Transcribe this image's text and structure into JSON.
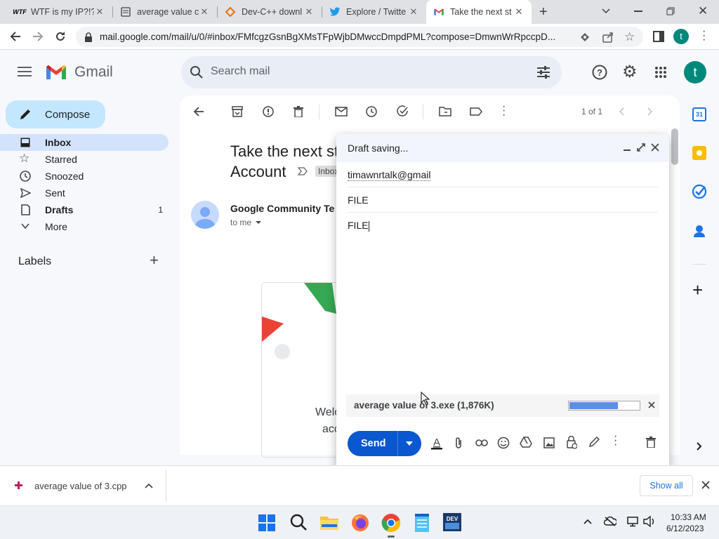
{
  "browser": {
    "tabs": [
      {
        "title": "WTF is my IP?!?!",
        "favicon": "WTF",
        "active": false
      },
      {
        "title": "average value c",
        "favicon": "doc-icon",
        "active": false
      },
      {
        "title": "Dev-C++ downl",
        "favicon": "diamond-icon",
        "active": false
      },
      {
        "title": "Explore / Twitte",
        "favicon": "twitter-icon",
        "active": false
      },
      {
        "title": "Take the next st",
        "favicon": "gmail-icon",
        "active": true
      }
    ],
    "url": "mail.google.com/mail/u/0/#inbox/FMfcgzGsnBgXMsTFpWjbDMwccDmpdPML?compose=DmwnWrRpccpD...",
    "profile_initial": "t"
  },
  "gmail": {
    "logo_text": "Gmail",
    "search_placeholder": "Search mail",
    "compose_label": "Compose",
    "nav": [
      {
        "label": "Inbox",
        "icon": "inbox-icon",
        "count": "",
        "selected": true
      },
      {
        "label": "Starred",
        "icon": "star-icon",
        "count": "",
        "selected": false
      },
      {
        "label": "Snoozed",
        "icon": "clock-icon",
        "count": "",
        "selected": false
      },
      {
        "label": "Sent",
        "icon": "send-icon",
        "count": "",
        "selected": false
      },
      {
        "label": "Drafts",
        "icon": "draft-icon",
        "count": "1",
        "selected": false
      },
      {
        "label": "More",
        "icon": "chevron-down-icon",
        "count": "",
        "selected": false
      }
    ],
    "labels_heading": "Labels",
    "account_initial": "t",
    "pager": "1 of 1",
    "email": {
      "subject_line1": "Take the next st",
      "subject_line2": "Account",
      "inbox_badge": "Inbox",
      "sender": "Google Community Te",
      "to": "to me",
      "body_fragment1": "Welc",
      "body_fragment2": "acc"
    }
  },
  "compose": {
    "status": "Draft saving...",
    "to": "timawnrtalk@gmail",
    "subject": "FILE",
    "body": "FILE",
    "attachment": {
      "name": "average value of 3.exe (1,876K)",
      "progress": 0.7
    },
    "send_label": "Send"
  },
  "download_bar": {
    "filename": "average value of 3.cpp",
    "show_all_label": "Show all"
  },
  "taskbar": {
    "time": "10:33 AM",
    "date": "6/12/2023"
  },
  "colors": {
    "accent": "#0b57d0",
    "compose_bg": "#c2e7ff",
    "selected_nav": "#d3e3fd",
    "avatar": "#00897b"
  }
}
